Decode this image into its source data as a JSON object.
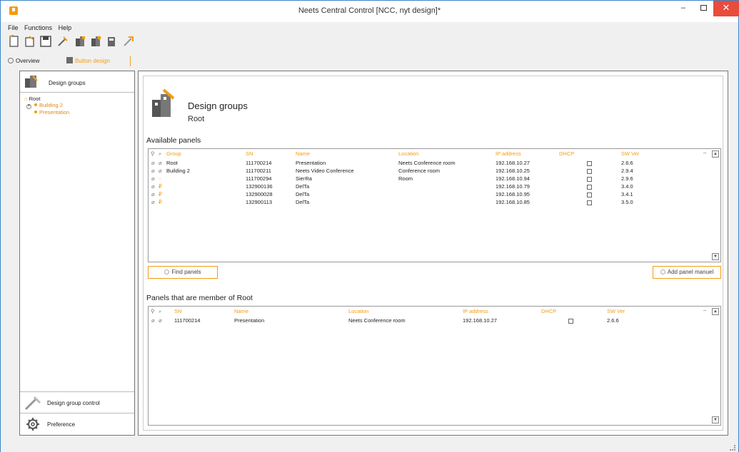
{
  "window": {
    "title": "Neets Central Control [NCC, nyt design]*"
  },
  "menu": [
    "File",
    "Functions",
    "Help"
  ],
  "tabs": [
    {
      "label": "Overview"
    },
    {
      "label": "Button design"
    }
  ],
  "sidebar": {
    "header_label": "Design groups",
    "tree": {
      "root": "Root",
      "children": [
        "Building 2",
        "Presentation"
      ]
    },
    "bottom_items": [
      "Design group control",
      "Preference"
    ]
  },
  "main": {
    "title": "Design groups",
    "subtitle": "Root",
    "available": {
      "title": "Available panels",
      "columns": [
        "Group",
        "SN",
        "Name",
        "Location",
        "IP address",
        "DHCP",
        "SW Ver"
      ],
      "rows": [
        {
          "group": "Root",
          "sn": "111700214",
          "name": "Presentation",
          "location": "Neets Conference room",
          "ip": "192.168.10.27",
          "sw": "2.6.6"
        },
        {
          "group": "Building 2",
          "sn": "111700211",
          "name": "Neets Video Conference",
          "location": "Conference room",
          "ip": "192.168.10.25",
          "sw": "2.9.4"
        },
        {
          "group": "",
          "sn": "111700294",
          "name": "SierRa",
          "location": "Room",
          "ip": "192.168.10.94",
          "sw": "2.9.6"
        },
        {
          "group": "",
          "sn": "132900136",
          "name": "DelTa",
          "location": "",
          "ip": "192.168.10.79",
          "sw": "3.4.0"
        },
        {
          "group": "",
          "sn": "132900028",
          "name": "DelTa",
          "location": "",
          "ip": "192.168.10.95",
          "sw": "3.4.1"
        },
        {
          "group": "",
          "sn": "132900113",
          "name": "DelTa",
          "location": "",
          "ip": "192.168.10.85",
          "sw": "3.5.0"
        }
      ],
      "find_button": "Find panels",
      "add_button": "Add panel manuel"
    },
    "members": {
      "title": "Panels that are member of Root",
      "columns": [
        "SN",
        "Name",
        "Location",
        "IP address",
        "DHCP",
        "SW Ver"
      ],
      "rows": [
        {
          "sn": "111700214",
          "name": "Presentation",
          "location": "Neets Conference room",
          "ip": "192.168.10.27",
          "sw": "2.6.6"
        }
      ]
    }
  },
  "colors": {
    "accent": "#f39c12",
    "close": "#e84c3d",
    "border": "#3b86c9"
  }
}
